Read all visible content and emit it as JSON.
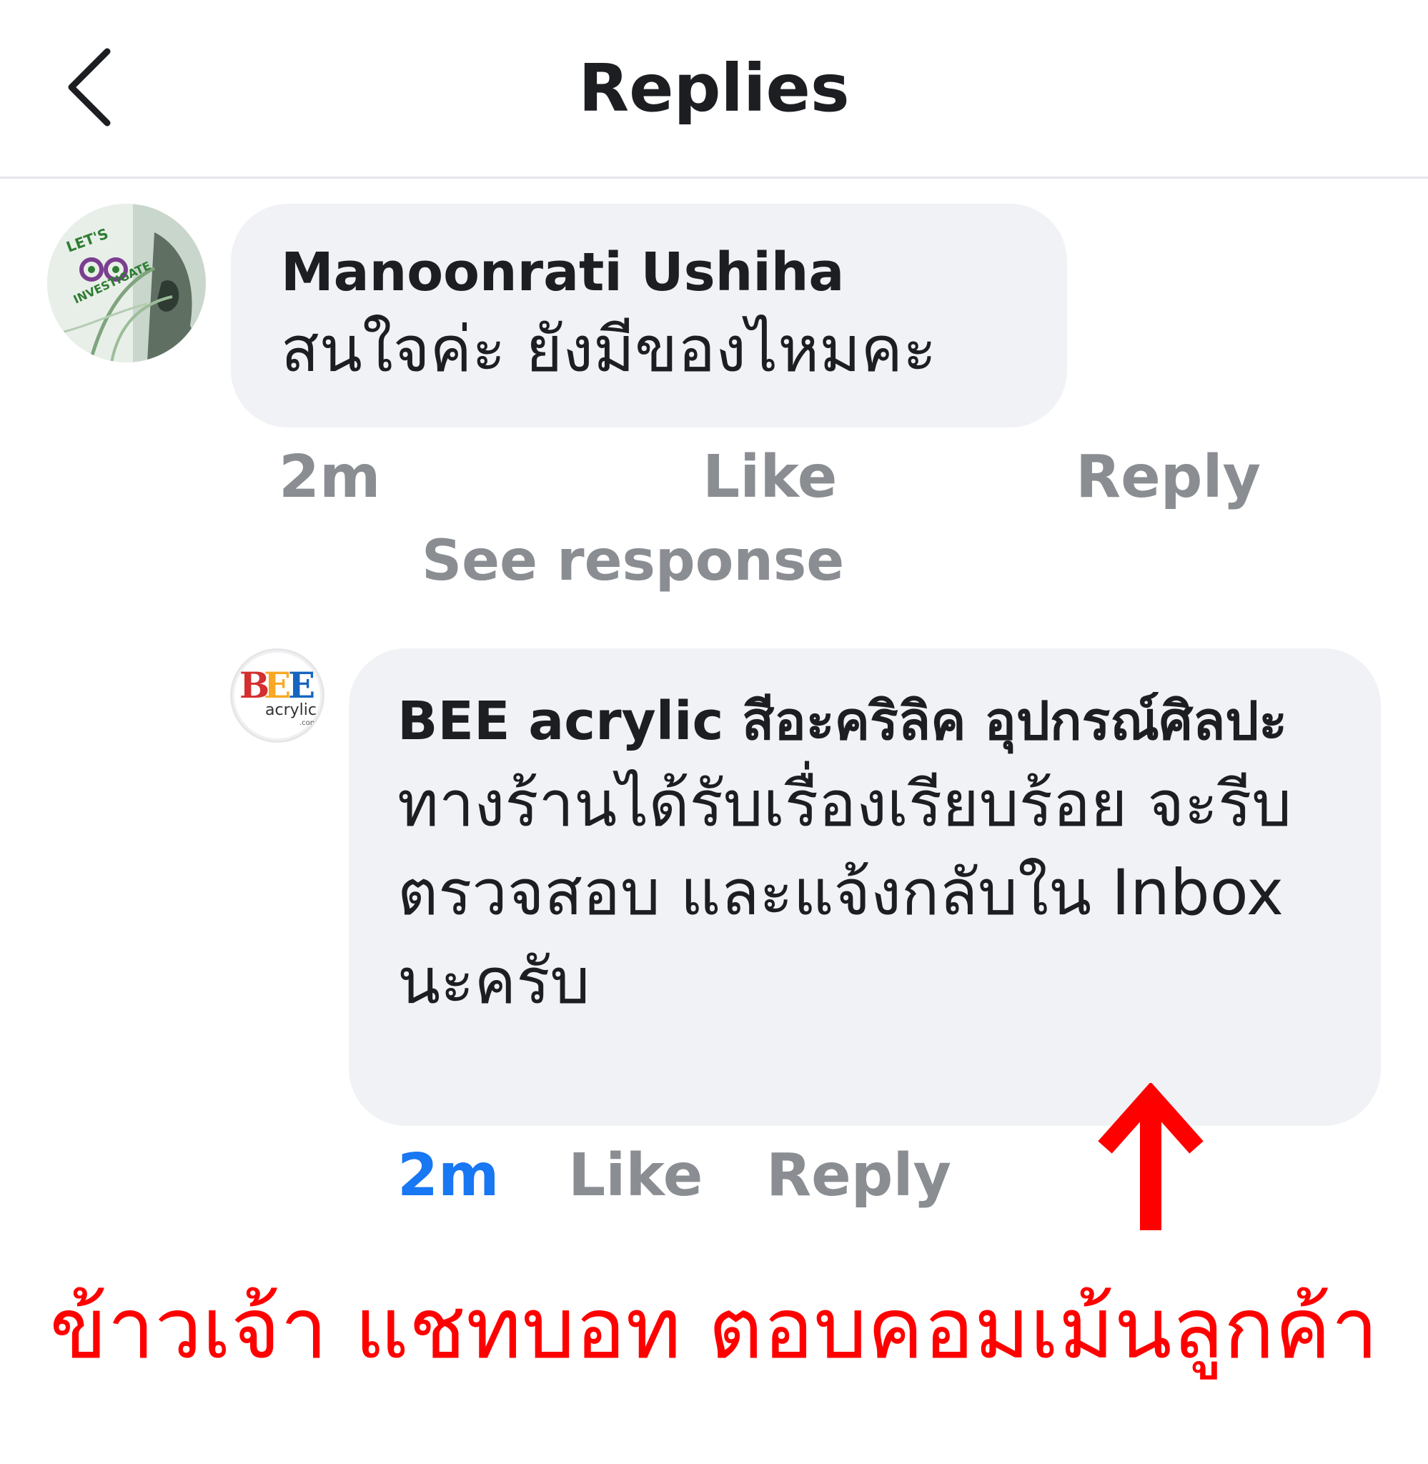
{
  "header": {
    "title": "Replies",
    "back_icon": "chevron-left-icon"
  },
  "comment": {
    "author": "Manoonrati Ushiha",
    "text": "สนใจค่ะ ยังมีของไหมคะ",
    "time": "2m",
    "like_label": "Like",
    "reply_label": "Reply",
    "see_response_label": "See response",
    "avatar_text": "LET'S INVESTIGATE"
  },
  "reply": {
    "author": "BEE acrylic สีอะคริลิค อุปกรณ์ศิลปะ",
    "text": "ทางร้านได้รับเรื่องเรียบร้อย จะรีบตรวจสอบ และแจ้งกลับใน Inbox นะครับ",
    "time": "2m",
    "like_label": "Like",
    "reply_label": "Reply",
    "avatar_logo": "BEE",
    "avatar_sub": "acrylic",
    "avatar_domain": ".com"
  },
  "annotation": {
    "caption": "ข้าวเจ้า แชทบอท ตอบคอมเม้นลูกค้า",
    "arrow_icon": "arrow-up-icon",
    "color": "#ff0000"
  },
  "colors": {
    "bubble": "#f0f2f5",
    "meta": "#8a8d91",
    "link_blue": "#1877f2"
  }
}
